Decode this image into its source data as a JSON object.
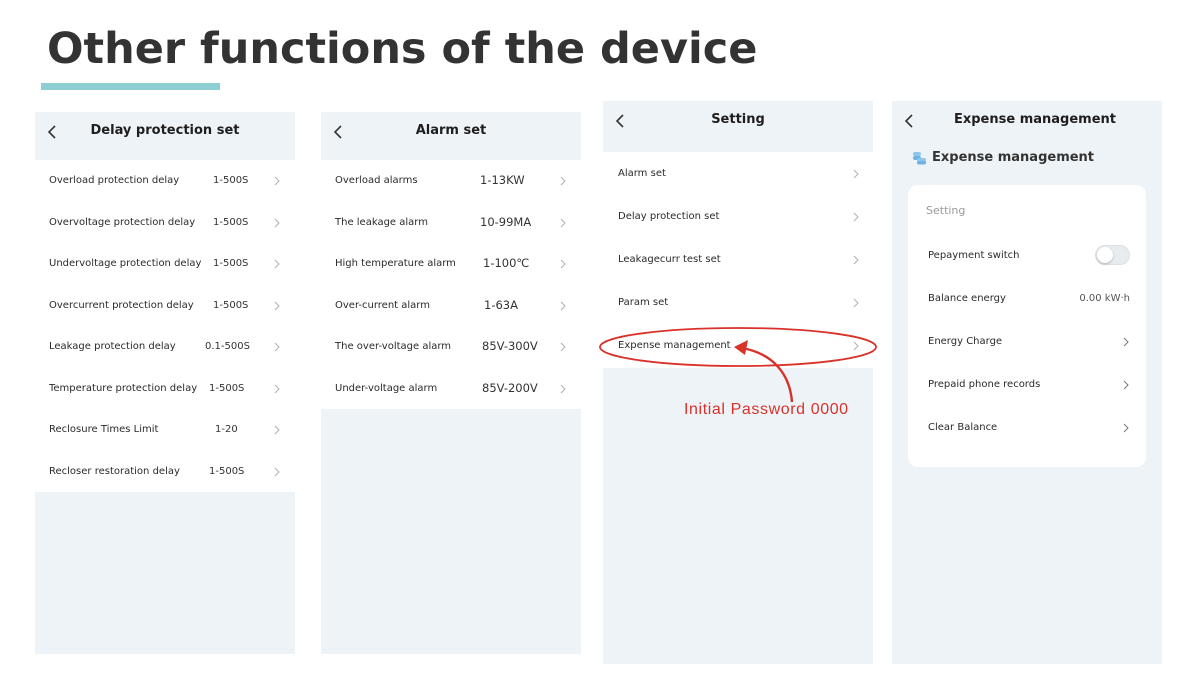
{
  "page": {
    "title": "Other functions of the device"
  },
  "delay_panel": {
    "title": "Delay protection set",
    "rows": [
      {
        "label": "Overload protection delay",
        "value": "1-500S"
      },
      {
        "label": "Overvoltage protection delay",
        "value": "1-500S"
      },
      {
        "label": "Undervoltage protection delay",
        "value": "1-500S"
      },
      {
        "label": "Overcurrent protection delay",
        "value": "1-500S"
      },
      {
        "label": "Leakage protection delay",
        "value": "0.1-500S"
      },
      {
        "label": "Temperature protection delay",
        "value": "1-500S"
      },
      {
        "label": "Reclosure Times Limit",
        "value": "1-20"
      },
      {
        "label": "Recloser restoration delay",
        "value": "1-500S"
      }
    ]
  },
  "alarm_panel": {
    "title": "Alarm set",
    "rows": [
      {
        "label": "Overload alarms",
        "value": "1-13KW"
      },
      {
        "label": "The leakage alarm",
        "value": "10-99MA"
      },
      {
        "label": "High temperature alarm",
        "value": "1-100℃"
      },
      {
        "label": "Over-current alarm",
        "value": "1-63A"
      },
      {
        "label": "The over-voltage alarm",
        "value": "85V-300V"
      },
      {
        "label": "Under-voltage alarm",
        "value": "85V-200V"
      }
    ]
  },
  "setting_panel": {
    "title": "Setting",
    "rows": [
      {
        "label": "Alarm set"
      },
      {
        "label": "Delay protection set"
      },
      {
        "label": "Leakagecurr test set"
      },
      {
        "label": "Param set"
      },
      {
        "label": "Expense management"
      }
    ]
  },
  "annotation": {
    "text": "Initial Password  0000",
    "color": "#d9322b"
  },
  "expense_panel": {
    "title": "Expense management",
    "section_title": "Expense management",
    "card_title": "Setting",
    "rows": [
      {
        "label": "Pepayment switch",
        "toggle": false
      },
      {
        "label": "Balance energy",
        "value": "0.00 kW·h"
      },
      {
        "label": "Energy Charge"
      },
      {
        "label": "Prepaid phone records"
      },
      {
        "label": "Clear Balance"
      }
    ]
  },
  "colors": {
    "accent_underline": "#8ecfd4",
    "panel_bg": "#eef3f7"
  }
}
